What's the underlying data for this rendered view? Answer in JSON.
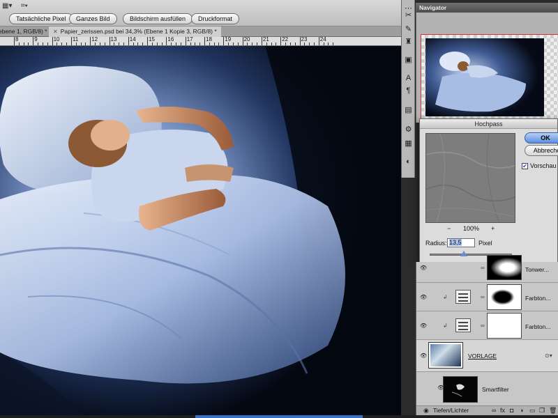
{
  "options_bar": {
    "buttons": [
      "Tatsächliche Pixel",
      "Ganzes Bild",
      "Bildschirm ausfüllen",
      "Druckformat"
    ]
  },
  "tabs": [
    {
      "label": "ebene 1, RGB/8) *",
      "active": false
    },
    {
      "label": "Papier_zerissen.psd bei 34,3% (Ebene 1 Kopie 3, RGB/8) *",
      "active": true
    }
  ],
  "ruler": {
    "labels": [
      "8",
      "9",
      "10",
      "11",
      "12",
      "13",
      "14",
      "15",
      "16",
      "17",
      "18",
      "19",
      "20",
      "21",
      "22",
      "23",
      "24"
    ]
  },
  "navigator": {
    "title": "Navigator"
  },
  "dialog": {
    "title": "Hochpass",
    "ok_label": "OK",
    "cancel_label": "Abbrechen",
    "preview_label": "Vorschau",
    "preview_checked": true,
    "zoom_minus": "−",
    "zoom_value": "100%",
    "zoom_plus": "+",
    "radius_label": "Radius:",
    "radius_value": "13,5",
    "radius_unit": "Pixel"
  },
  "layers": {
    "items": [
      {
        "name": "Tonwer..."
      },
      {
        "name": "Farbton..."
      },
      {
        "name": "Farbton..."
      },
      {
        "name": "VORLAGE"
      },
      {
        "name": "Smartfilter"
      },
      {
        "name": "Tiefen/Lichter"
      }
    ]
  },
  "icons": {
    "eye": "eye-icon",
    "link": "chain-link-icon",
    "fx": "fx-icon",
    "mask": "mask-icon",
    "adjustment": "adjustment-layer-icon",
    "folder": "folder-icon",
    "new": "new-layer-icon",
    "trash": "trash-icon"
  },
  "colors": {
    "ok_button": "#5d8fe0",
    "selection": "#a9c3ee"
  }
}
